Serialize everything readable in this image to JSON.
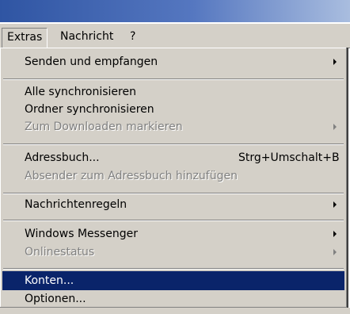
{
  "menubar": {
    "items": [
      {
        "label": "Extras"
      },
      {
        "label": "Nachricht"
      },
      {
        "label": "?"
      }
    ]
  },
  "menu": {
    "items": [
      {
        "label": "Senden und empfangen",
        "submenu": true
      },
      {
        "label": "Alle synchronisieren"
      },
      {
        "label": "Ordner synchronisieren"
      },
      {
        "label": "Zum Downloaden markieren",
        "disabled": true,
        "submenu": true
      },
      {
        "label": "Adressbuch...",
        "shortcut": "Strg+Umschalt+B"
      },
      {
        "label": "Absender zum Adressbuch hinzufügen",
        "disabled": true
      },
      {
        "label": "Nachrichtenregeln",
        "submenu": true
      },
      {
        "label": "Windows Messenger",
        "submenu": true
      },
      {
        "label": "Onlinestatus",
        "disabled": true,
        "submenu": true
      },
      {
        "label": "Konten...",
        "selected": true
      },
      {
        "label": "Optionen..."
      }
    ]
  },
  "colors": {
    "menu_bg": "#d4d0c8",
    "highlight": "#0a246a",
    "disabled_text": "#808080",
    "titlebar": "#2f55a3"
  }
}
